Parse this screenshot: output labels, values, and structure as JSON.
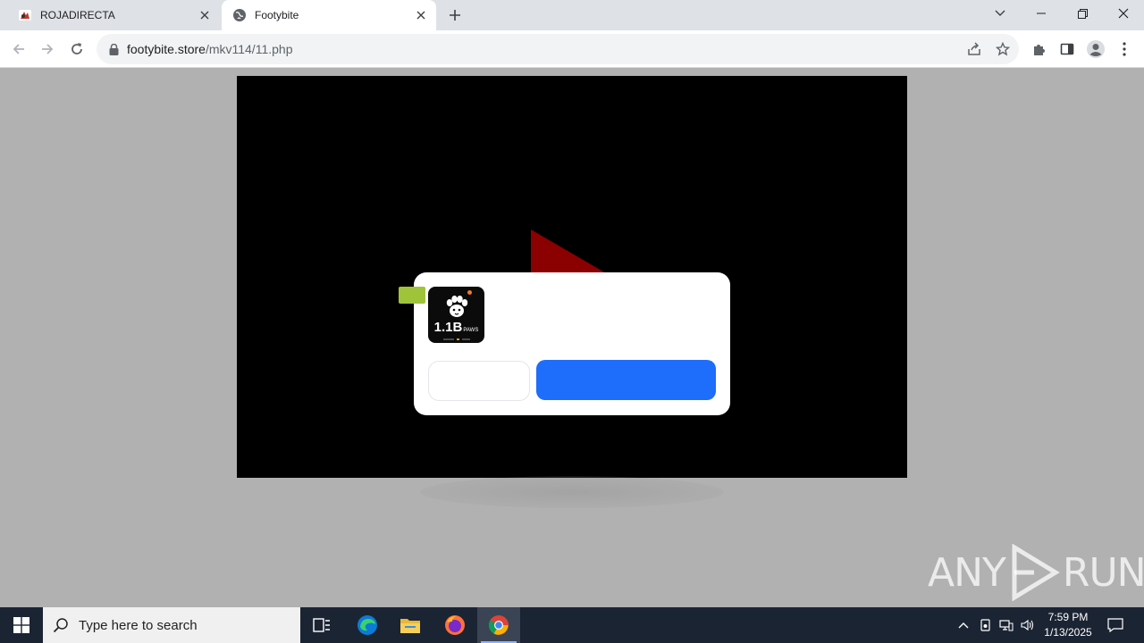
{
  "browser": {
    "tabs": [
      {
        "title": "ROJADIRECTA",
        "active": false,
        "favicon": "rojadirecta-favicon"
      },
      {
        "title": "Footybite",
        "active": true,
        "favicon": "globe-icon"
      }
    ],
    "address": {
      "host": "footybite.store",
      "path": "/mkv114/11.php"
    }
  },
  "popup": {
    "app_amount": "1.1B",
    "app_unit": "PAWS",
    "badge_color": "#9fc43a",
    "primary_color": "#1e6dfb"
  },
  "watermark": {
    "left": "ANY",
    "right": "RUN"
  },
  "taskbar": {
    "search_placeholder": "Type here to search",
    "time": "7:59 PM",
    "date": "1/13/2025"
  }
}
